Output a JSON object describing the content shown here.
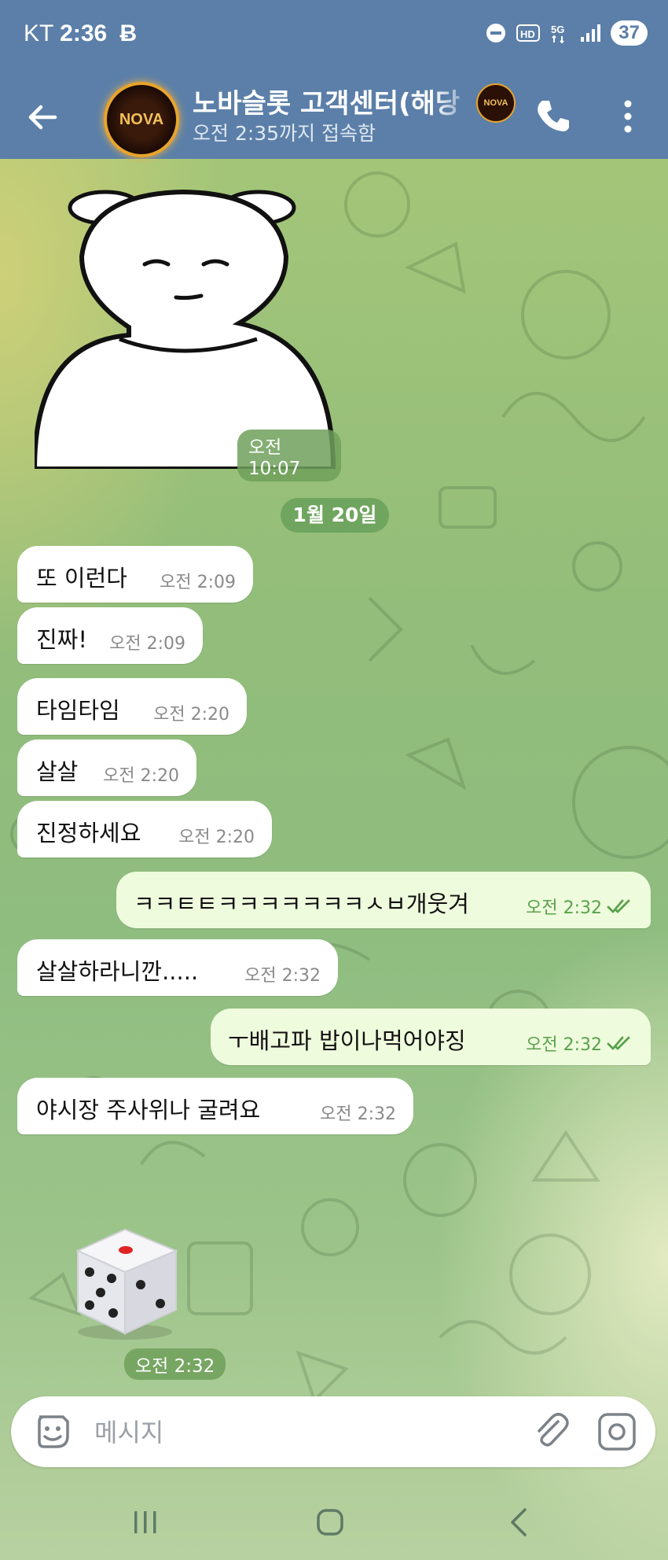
{
  "status_bar": {
    "carrier": "KT",
    "time": "2:36",
    "battery": "37"
  },
  "header": {
    "title": "노바슬롯 고객센터(해당",
    "subtitle": "오전 2:35까지 접속함",
    "avatar_text": "NOVA"
  },
  "sticker": {
    "time": "오전 10:07"
  },
  "date_divider": "1월 20일",
  "messages": [
    {
      "text": "또 이런다",
      "time": "오전 2:09",
      "direction": "in"
    },
    {
      "text": "진짜!",
      "time": "오전 2:09",
      "direction": "in"
    },
    {
      "text": "타임타임",
      "time": "오전 2:20",
      "direction": "in"
    },
    {
      "text": "살살",
      "time": "오전 2:20",
      "direction": "in"
    },
    {
      "text": "진정하세요",
      "time": "오전 2:20",
      "direction": "in"
    },
    {
      "text": "ㅋㅋㅌㅌㅋㅋㅋㅋㅋㅋㅋㅅㅂ개웃겨",
      "time": "오전 2:32",
      "direction": "out",
      "read": true
    },
    {
      "text": "살살하라니깐.....",
      "time": "오전 2:32",
      "direction": "in"
    },
    {
      "text": "ㅜ배고파 밥이나먹어야징",
      "time": "오전 2:32",
      "direction": "out",
      "read": true
    },
    {
      "text": "야시장 주사위나 굴려요",
      "time": "오전 2:32",
      "direction": "in"
    }
  ],
  "dice": {
    "time": "오전 2:32"
  },
  "composer": {
    "placeholder": "메시지"
  },
  "colors": {
    "header": "#5b7fa8",
    "outgoing_bubble": "#eefbdc",
    "read_check": "#5aa14d",
    "date_pill": "#6fa55e"
  },
  "icons": [
    "back-arrow-icon",
    "phone-icon",
    "more-vert-icon",
    "sticker-icon",
    "attach-icon",
    "camera-icon",
    "double-check-icon"
  ]
}
